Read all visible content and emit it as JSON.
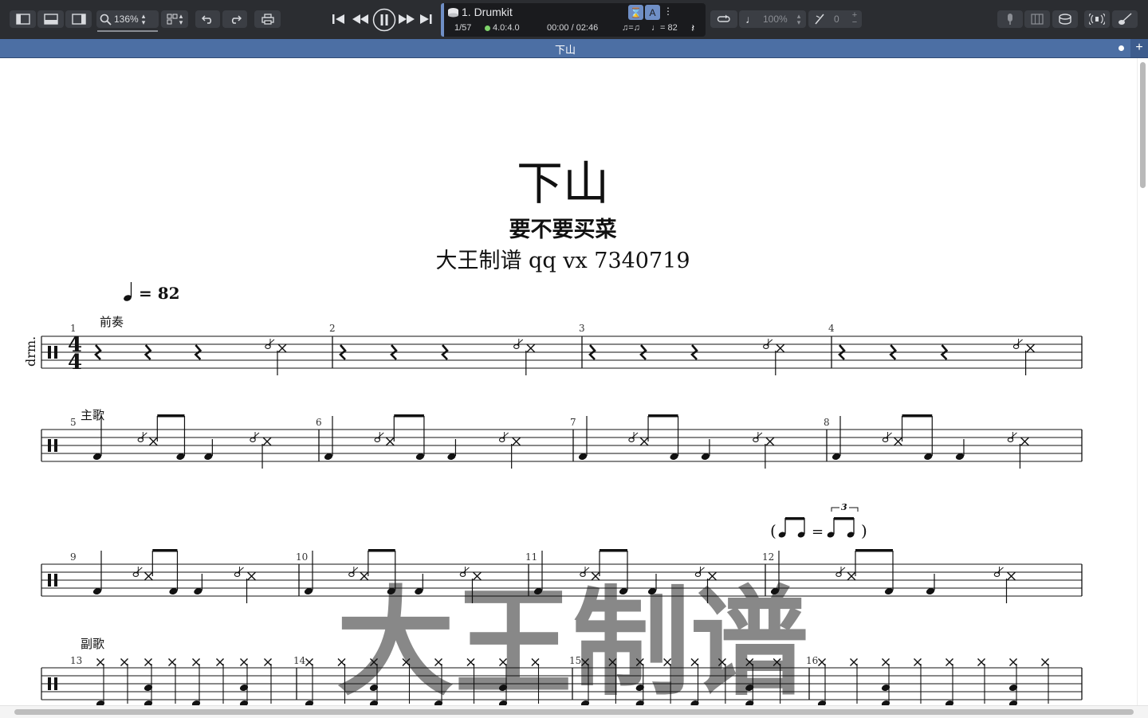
{
  "toolbar": {
    "zoom_value": "136%",
    "track_name": "1. Drumkit",
    "bar_position": "1/57",
    "beat_position": "4.0:4.0",
    "time_position": "00:00 / 02:46",
    "tempo_display": "♩= 82",
    "swing_display": "♫=♫",
    "speed_value": "100%",
    "transpose_value": "0",
    "hl_button_a": "⌛",
    "hl_button_b": "A"
  },
  "tab": {
    "title": "下山"
  },
  "score": {
    "title": "下山",
    "subtitle": "要不要买菜",
    "composer": "大王制谱 qq vx 7340719",
    "tempo_text": "= 82",
    "instrument": "drm.",
    "time_sig_top": "4",
    "time_sig_bottom": "4",
    "sections": [
      "前奏",
      "主歌",
      "副歌"
    ],
    "bar_numbers": [
      "1",
      "2",
      "3",
      "4",
      "5",
      "6",
      "7",
      "8",
      "9",
      "10",
      "11",
      "12",
      "13",
      "14",
      "15",
      "16"
    ],
    "swing_marking": {
      "open": "(",
      "equals": "=",
      "tuplet": "3",
      "close": ")"
    },
    "watermark": "大王制谱"
  }
}
